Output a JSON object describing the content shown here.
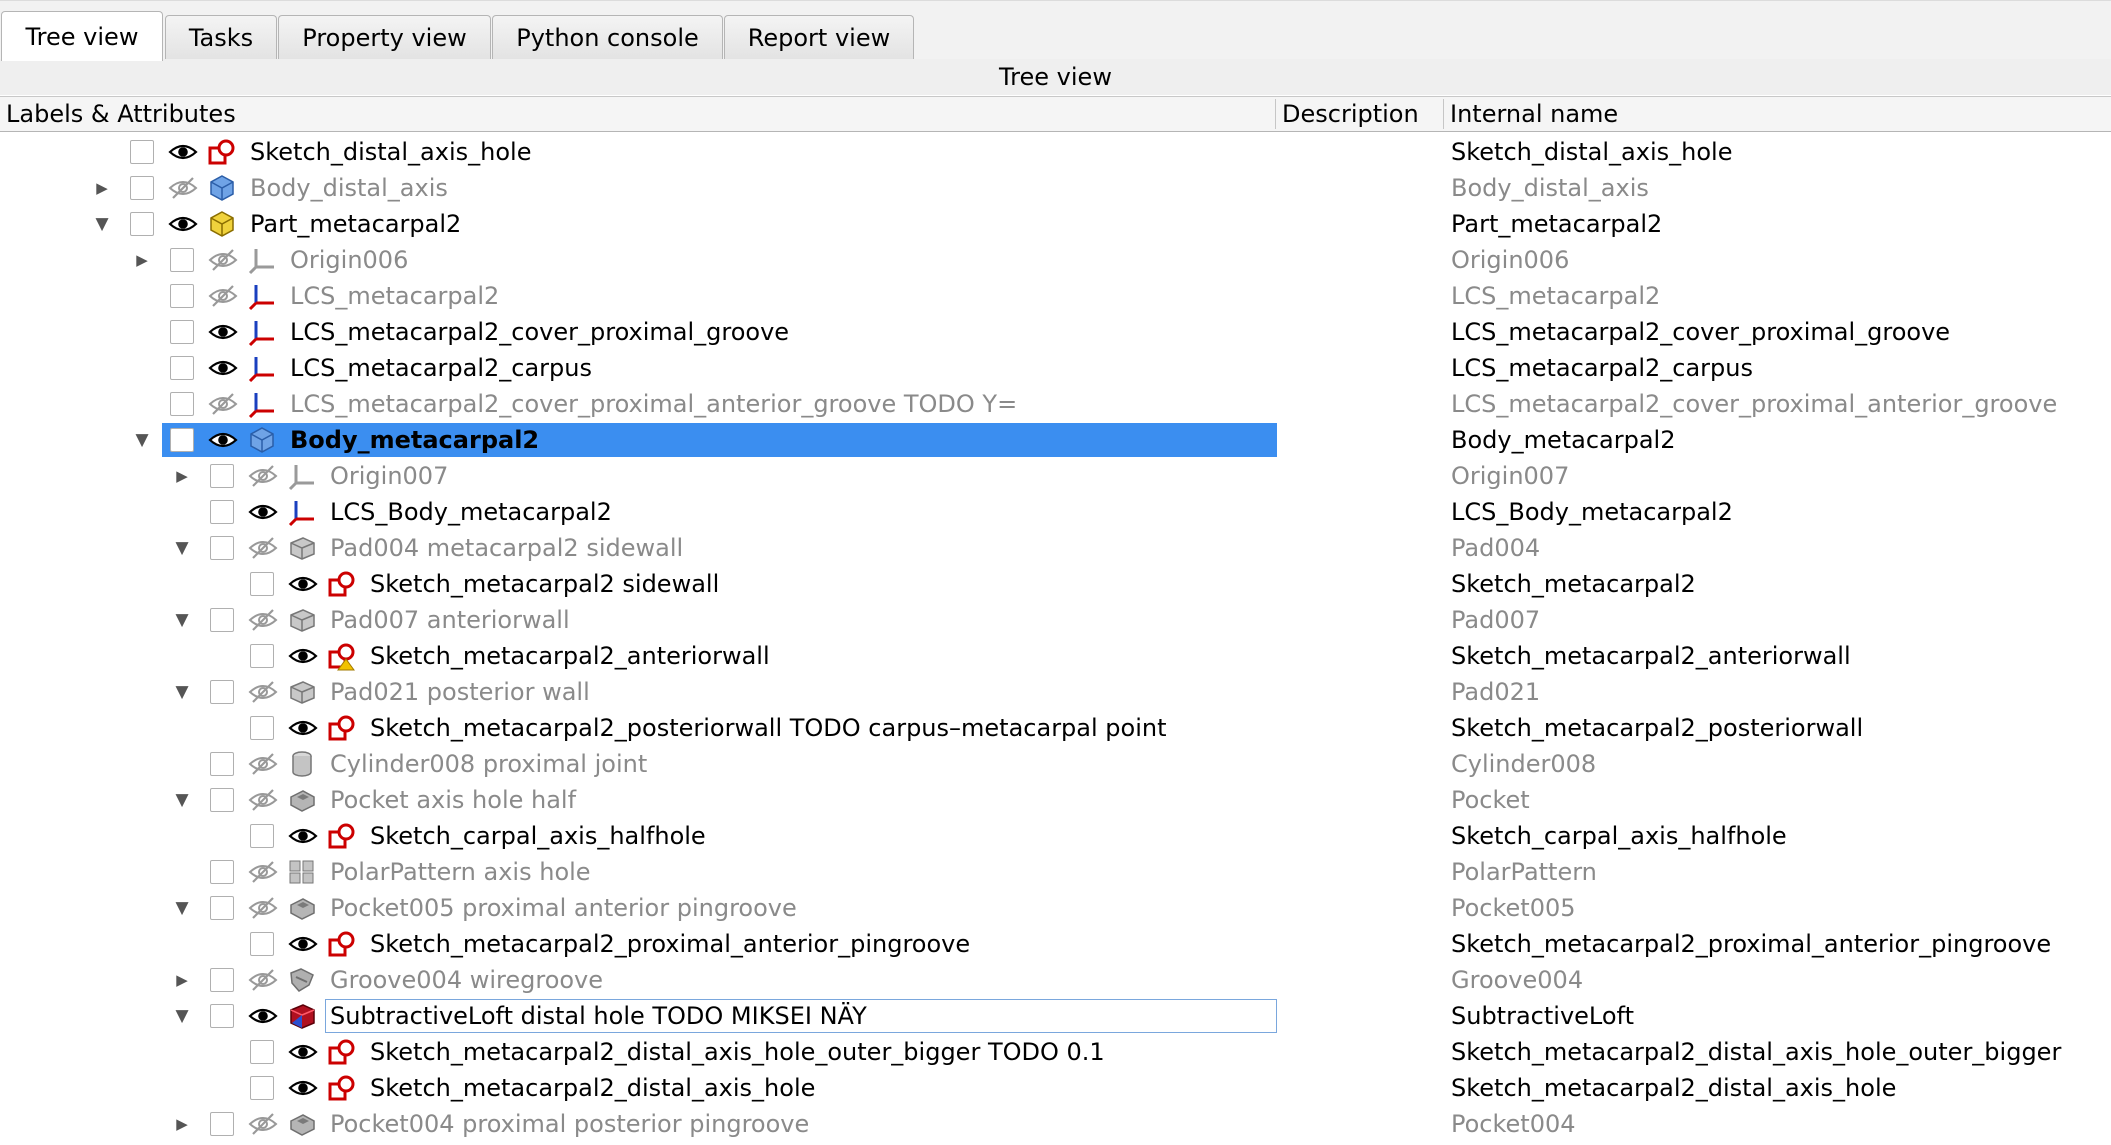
{
  "tabs": [
    {
      "label": "Tree view",
      "active": true
    },
    {
      "label": "Tasks",
      "active": false
    },
    {
      "label": "Property view",
      "active": false
    },
    {
      "label": "Python console",
      "active": false
    },
    {
      "label": "Report view",
      "active": false
    }
  ],
  "panel": {
    "title": "Tree view"
  },
  "columns": {
    "labels": "Labels & Attributes",
    "description": "Description",
    "internal": "Internal name"
  },
  "colors": {
    "selection": "#3b8ef0",
    "hidden_text": "#8a8a8a",
    "sketch_red": "#cc0000",
    "body_blue": "#3a7bd5",
    "part_yellow": "#e6c619"
  },
  "rows": [
    {
      "label": "Sketch_distal_axis_hole",
      "internal": "Sketch_distal_axis_hole",
      "depth": 0,
      "expander": "none",
      "visible": true,
      "icon": "sketch-icon"
    },
    {
      "label": "Body_distal_axis",
      "internal": "Body_distal_axis",
      "depth": 0,
      "expander": "collapsed",
      "visible": false,
      "icon": "body-icon"
    },
    {
      "label": "Part_metacarpal2",
      "internal": "Part_metacarpal2",
      "depth": 0,
      "expander": "expanded",
      "visible": true,
      "icon": "part-icon"
    },
    {
      "label": "Origin006",
      "internal": "Origin006",
      "depth": 1,
      "expander": "collapsed",
      "visible": false,
      "icon": "origin-icon"
    },
    {
      "label": "LCS_metacarpal2",
      "internal": "LCS_metacarpal2",
      "depth": 1,
      "expander": "none",
      "visible": false,
      "icon": "lcs-icon"
    },
    {
      "label": "LCS_metacarpal2_cover_proximal_groove",
      "internal": "LCS_metacarpal2_cover_proximal_groove",
      "depth": 1,
      "expander": "none",
      "visible": true,
      "icon": "lcs-icon"
    },
    {
      "label": "LCS_metacarpal2_carpus",
      "internal": "LCS_metacarpal2_carpus",
      "depth": 1,
      "expander": "none",
      "visible": true,
      "icon": "lcs-icon"
    },
    {
      "label": "LCS_metacarpal2_cover_proximal_anterior_groove TODO Y=",
      "internal": "LCS_metacarpal2_cover_proximal_anterior_groove",
      "depth": 1,
      "expander": "none",
      "visible": false,
      "icon": "lcs-icon"
    },
    {
      "label": "Body_metacarpal2",
      "internal": "Body_metacarpal2",
      "depth": 1,
      "expander": "expanded",
      "visible": true,
      "icon": "body-icon",
      "selected": true
    },
    {
      "label": "Origin007",
      "internal": "Origin007",
      "depth": 2,
      "expander": "collapsed",
      "visible": false,
      "icon": "origin-icon"
    },
    {
      "label": "LCS_Body_metacarpal2",
      "internal": "LCS_Body_metacarpal2",
      "depth": 2,
      "expander": "none",
      "visible": true,
      "icon": "lcs-icon"
    },
    {
      "label": "Pad004 metacarpal2 sidewall",
      "internal": "Pad004",
      "depth": 2,
      "expander": "expanded",
      "visible": false,
      "icon": "pad-icon"
    },
    {
      "label": "Sketch_metacarpal2 sidewall",
      "internal": "Sketch_metacarpal2",
      "depth": 3,
      "expander": "none",
      "visible": true,
      "icon": "sketch-icon"
    },
    {
      "label": "Pad007 anteriorwall",
      "internal": "Pad007",
      "depth": 2,
      "expander": "expanded",
      "visible": false,
      "icon": "pad-icon"
    },
    {
      "label": "Sketch_metacarpal2_anteriorwall",
      "internal": "Sketch_metacarpal2_anteriorwall",
      "depth": 3,
      "expander": "none",
      "visible": true,
      "icon": "sketch-warning-icon"
    },
    {
      "label": "Pad021 posterior wall",
      "internal": "Pad021",
      "depth": 2,
      "expander": "expanded",
      "visible": false,
      "icon": "pad-icon"
    },
    {
      "label": "Sketch_metacarpal2_posteriorwall TODO carpus–metacarpal point",
      "internal": "Sketch_metacarpal2_posteriorwall",
      "depth": 3,
      "expander": "none",
      "visible": true,
      "icon": "sketch-icon"
    },
    {
      "label": "Cylinder008 proximal joint",
      "internal": "Cylinder008",
      "depth": 2,
      "expander": "none",
      "visible": false,
      "icon": "cylinder-icon"
    },
    {
      "label": "Pocket axis hole half",
      "internal": "Pocket",
      "depth": 2,
      "expander": "expanded",
      "visible": false,
      "icon": "pocket-icon"
    },
    {
      "label": "Sketch_carpal_axis_halfhole",
      "internal": "Sketch_carpal_axis_halfhole",
      "depth": 3,
      "expander": "none",
      "visible": true,
      "icon": "sketch-icon"
    },
    {
      "label": "PolarPattern axis hole",
      "internal": "PolarPattern",
      "depth": 2,
      "expander": "none",
      "visible": false,
      "icon": "polar-pattern-icon"
    },
    {
      "label": "Pocket005 proximal anterior pingroove",
      "internal": "Pocket005",
      "depth": 2,
      "expander": "expanded",
      "visible": false,
      "icon": "pocket-icon"
    },
    {
      "label": "Sketch_metacarpal2_proximal_anterior_pingroove",
      "internal": "Sketch_metacarpal2_proximal_anterior_pingroove",
      "depth": 3,
      "expander": "none",
      "visible": true,
      "icon": "sketch-icon"
    },
    {
      "label": "Groove004 wiregroove",
      "internal": "Groove004",
      "depth": 2,
      "expander": "collapsed",
      "visible": false,
      "icon": "groove-icon"
    },
    {
      "label": "SubtractiveLoft distal hole TODO MIKSEI NÄY",
      "internal": "SubtractiveLoft",
      "depth": 2,
      "expander": "expanded",
      "visible": true,
      "icon": "subtractive-loft-icon",
      "editing": true
    },
    {
      "label": "Sketch_metacarpal2_distal_axis_hole_outer_bigger TODO 0.1",
      "internal": "Sketch_metacarpal2_distal_axis_hole_outer_bigger",
      "depth": 3,
      "expander": "none",
      "visible": true,
      "icon": "sketch-icon"
    },
    {
      "label": "Sketch_metacarpal2_distal_axis_hole",
      "internal": "Sketch_metacarpal2_distal_axis_hole",
      "depth": 3,
      "expander": "none",
      "visible": true,
      "icon": "sketch-icon"
    },
    {
      "label": "Pocket004 proximal posterior pingroove",
      "internal": "Pocket004",
      "depth": 2,
      "expander": "collapsed",
      "visible": false,
      "icon": "pocket-icon"
    }
  ]
}
